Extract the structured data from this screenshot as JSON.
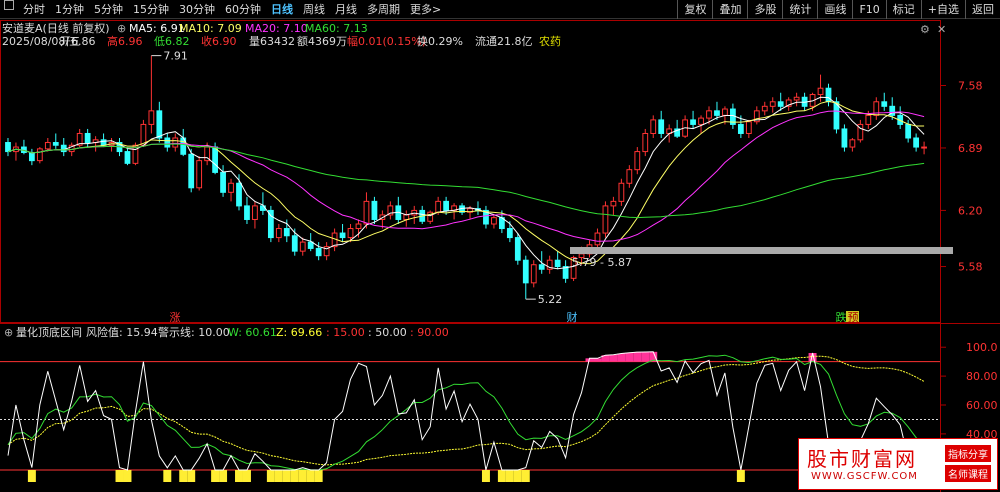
{
  "toolbar": {
    "timeframes": [
      "分时",
      "1分钟",
      "5分钟",
      "15分钟",
      "30分钟",
      "60分钟",
      "日线",
      "周线",
      "月线",
      "多周期",
      "更多>"
    ],
    "active_timeframe": "日线",
    "right_buttons": [
      "复权",
      "叠加",
      "多股",
      "统计",
      "画线",
      "F10",
      "标记",
      "+自选",
      "返回"
    ]
  },
  "header": {
    "title": "安道麦A(日线 前复权)",
    "ma5": "MA5: 6.91",
    "ma10": "MA10: 7.09",
    "ma20": "MA20: 7.10",
    "ma60": "MA60: 7.13",
    "date": "2025/08/08/五",
    "open": "开6.86",
    "high": "高6.96",
    "low": "低6.82",
    "close": "收6.90",
    "volume": "量63432",
    "amount": "额4369万",
    "change": "幅0.01(0.15%)",
    "turnover": "换0.29%",
    "float": "流通21.8亿",
    "sector": "农药"
  },
  "colors": {
    "up": "#ff3333",
    "down": "#33ffff",
    "ma5": "#ffffff",
    "ma10": "#ffff66",
    "ma20": "#ff33ff",
    "ma60": "#33dd33"
  },
  "annotations": {
    "high_label": "7.91",
    "low_label": "5.22",
    "range_label": "5.79 - 5.87",
    "marker_zhang": "涨",
    "marker_cai": "财",
    "marker_diezhi": "跌",
    "marker_yu": "预"
  },
  "indicator": {
    "title": "量化顶底区间",
    "risk": "风险值: 15.94",
    "warn": "警示线: 10.00",
    "w": "W: 60.61",
    "z": "Z: 69.66",
    "v15": ": 15.00",
    "v50": ": 50.00",
    "v90": ": 90.00"
  },
  "watermark": {
    "main": "股市财富网",
    "url": "WWW.GSCFW.COM",
    "tag1": "指标分享",
    "tag2": "名师课程"
  },
  "chart_data": {
    "type": "candlestick",
    "price_axis_ticks": [
      7.58,
      6.89,
      6.2,
      5.58
    ],
    "indicator_axis_ticks": [
      100.0,
      80.0,
      60.0,
      40.0
    ],
    "price_range": [
      5.1,
      7.95
    ],
    "indicator_range": [
      15,
      105
    ],
    "candles": [
      [
        6.95,
        7.0,
        6.8,
        6.85
      ],
      [
        6.85,
        6.95,
        6.75,
        6.9
      ],
      [
        6.9,
        6.98,
        6.82,
        6.84
      ],
      [
        6.84,
        6.88,
        6.7,
        6.75
      ],
      [
        6.75,
        6.9,
        6.72,
        6.88
      ],
      [
        6.88,
        7.0,
        6.85,
        6.95
      ],
      [
        6.95,
        7.05,
        6.88,
        6.92
      ],
      [
        6.92,
        7.0,
        6.8,
        6.85
      ],
      [
        6.85,
        6.95,
        6.8,
        6.92
      ],
      [
        6.92,
        7.1,
        6.9,
        7.05
      ],
      [
        7.05,
        7.1,
        6.9,
        6.95
      ],
      [
        6.95,
        7.02,
        6.85,
        6.98
      ],
      [
        6.98,
        7.05,
        6.9,
        6.92
      ],
      [
        6.92,
        7.0,
        6.85,
        6.95
      ],
      [
        6.95,
        7.0,
        6.8,
        6.85
      ],
      [
        6.85,
        6.9,
        6.7,
        6.72
      ],
      [
        6.72,
        6.95,
        6.7,
        6.92
      ],
      [
        6.92,
        7.2,
        6.9,
        7.15
      ],
      [
        7.15,
        7.91,
        7.05,
        7.3
      ],
      [
        7.3,
        7.4,
        6.95,
        7.0
      ],
      [
        7.0,
        7.05,
        6.85,
        6.9
      ],
      [
        6.9,
        7.05,
        6.85,
        7.0
      ],
      [
        7.0,
        7.1,
        6.8,
        6.82
      ],
      [
        6.82,
        6.88,
        6.4,
        6.45
      ],
      [
        6.45,
        6.8,
        6.42,
        6.75
      ],
      [
        6.75,
        6.95,
        6.7,
        6.9
      ],
      [
        6.9,
        6.95,
        6.6,
        6.62
      ],
      [
        6.62,
        6.7,
        6.35,
        6.4
      ],
      [
        6.4,
        6.55,
        6.3,
        6.5
      ],
      [
        6.5,
        6.6,
        6.2,
        6.25
      ],
      [
        6.25,
        6.35,
        6.05,
        6.1
      ],
      [
        6.1,
        6.3,
        6.0,
        6.25
      ],
      [
        6.25,
        6.4,
        6.15,
        6.2
      ],
      [
        6.2,
        6.25,
        5.85,
        5.9
      ],
      [
        5.9,
        6.05,
        5.85,
        6.0
      ],
      [
        6.0,
        6.1,
        5.85,
        5.92
      ],
      [
        5.92,
        6.0,
        5.7,
        5.75
      ],
      [
        5.75,
        5.9,
        5.7,
        5.85
      ],
      [
        5.85,
        5.95,
        5.75,
        5.78
      ],
      [
        5.78,
        5.85,
        5.65,
        5.7
      ],
      [
        5.7,
        5.85,
        5.65,
        5.8
      ],
      [
        5.8,
        6.0,
        5.75,
        5.95
      ],
      [
        5.95,
        6.05,
        5.85,
        5.9
      ],
      [
        5.9,
        6.05,
        5.85,
        6.0
      ],
      [
        6.0,
        6.1,
        5.9,
        6.05
      ],
      [
        6.05,
        6.4,
        6.0,
        6.3
      ],
      [
        6.3,
        6.35,
        6.05,
        6.1
      ],
      [
        6.1,
        6.2,
        6.0,
        6.15
      ],
      [
        6.15,
        6.3,
        6.1,
        6.25
      ],
      [
        6.25,
        6.35,
        6.05,
        6.1
      ],
      [
        6.1,
        6.2,
        6.02,
        6.15
      ],
      [
        6.15,
        6.25,
        6.05,
        6.2
      ],
      [
        6.2,
        6.25,
        6.05,
        6.08
      ],
      [
        6.08,
        6.2,
        6.05,
        6.18
      ],
      [
        6.18,
        6.35,
        6.15,
        6.3
      ],
      [
        6.3,
        6.35,
        6.15,
        6.2
      ],
      [
        6.2,
        6.28,
        6.1,
        6.25
      ],
      [
        6.25,
        6.28,
        6.15,
        6.18
      ],
      [
        6.18,
        6.25,
        6.1,
        6.22
      ],
      [
        6.22,
        6.3,
        6.15,
        6.2
      ],
      [
        6.2,
        6.25,
        6.0,
        6.05
      ],
      [
        6.05,
        6.15,
        6.0,
        6.12
      ],
      [
        6.12,
        6.2,
        5.95,
        6.0
      ],
      [
        6.0,
        6.08,
        5.85,
        5.9
      ],
      [
        5.9,
        5.95,
        5.6,
        5.65
      ],
      [
        5.65,
        5.7,
        5.22,
        5.4
      ],
      [
        5.4,
        5.65,
        5.35,
        5.6
      ],
      [
        5.6,
        5.75,
        5.5,
        5.55
      ],
      [
        5.55,
        5.7,
        5.5,
        5.65
      ],
      [
        5.65,
        5.75,
        5.55,
        5.58
      ],
      [
        5.58,
        5.65,
        5.4,
        5.45
      ],
      [
        5.45,
        5.7,
        5.42,
        5.68
      ],
      [
        5.68,
        5.8,
        5.6,
        5.72
      ],
      [
        5.72,
        5.87,
        5.68,
        5.82
      ],
      [
        5.82,
        6.0,
        5.78,
        5.95
      ],
      [
        5.95,
        6.3,
        5.9,
        6.25
      ],
      [
        6.25,
        6.35,
        6.15,
        6.3
      ],
      [
        6.3,
        6.55,
        6.25,
        6.5
      ],
      [
        6.5,
        6.7,
        6.45,
        6.65
      ],
      [
        6.65,
        6.9,
        6.6,
        6.85
      ],
      [
        6.85,
        7.1,
        6.8,
        7.05
      ],
      [
        7.05,
        7.25,
        7.0,
        7.2
      ],
      [
        7.2,
        7.3,
        7.0,
        7.05
      ],
      [
        7.05,
        7.15,
        6.95,
        7.1
      ],
      [
        7.1,
        7.2,
        7.0,
        7.02
      ],
      [
        7.02,
        7.25,
        7.0,
        7.2
      ],
      [
        7.2,
        7.3,
        7.1,
        7.15
      ],
      [
        7.15,
        7.25,
        7.05,
        7.22
      ],
      [
        7.22,
        7.35,
        7.15,
        7.3
      ],
      [
        7.3,
        7.4,
        7.2,
        7.25
      ],
      [
        7.25,
        7.35,
        7.15,
        7.32
      ],
      [
        7.32,
        7.38,
        7.1,
        7.15
      ],
      [
        7.15,
        7.25,
        7.0,
        7.05
      ],
      [
        7.05,
        7.2,
        7.0,
        7.18
      ],
      [
        7.18,
        7.35,
        7.15,
        7.3
      ],
      [
        7.3,
        7.4,
        7.25,
        7.35
      ],
      [
        7.35,
        7.45,
        7.28,
        7.4
      ],
      [
        7.4,
        7.5,
        7.3,
        7.35
      ],
      [
        7.35,
        7.45,
        7.3,
        7.42
      ],
      [
        7.42,
        7.5,
        7.35,
        7.45
      ],
      [
        7.45,
        7.5,
        7.3,
        7.35
      ],
      [
        7.35,
        7.5,
        7.3,
        7.48
      ],
      [
        7.48,
        7.7,
        7.4,
        7.55
      ],
      [
        7.55,
        7.6,
        7.35,
        7.4
      ],
      [
        7.4,
        7.45,
        7.05,
        7.1
      ],
      [
        7.1,
        7.15,
        6.85,
        6.9
      ],
      [
        6.9,
        7.0,
        6.85,
        6.98
      ],
      [
        6.98,
        7.2,
        6.95,
        7.15
      ],
      [
        7.15,
        7.3,
        7.1,
        7.25
      ],
      [
        7.25,
        7.45,
        7.2,
        7.4
      ],
      [
        7.4,
        7.5,
        7.3,
        7.35
      ],
      [
        7.35,
        7.45,
        7.2,
        7.25
      ],
      [
        7.25,
        7.35,
        7.1,
        7.15
      ],
      [
        7.15,
        7.2,
        6.95,
        7.0
      ],
      [
        7.0,
        7.05,
        6.85,
        6.9
      ],
      [
        6.9,
        6.96,
        6.82,
        6.9
      ]
    ]
  }
}
